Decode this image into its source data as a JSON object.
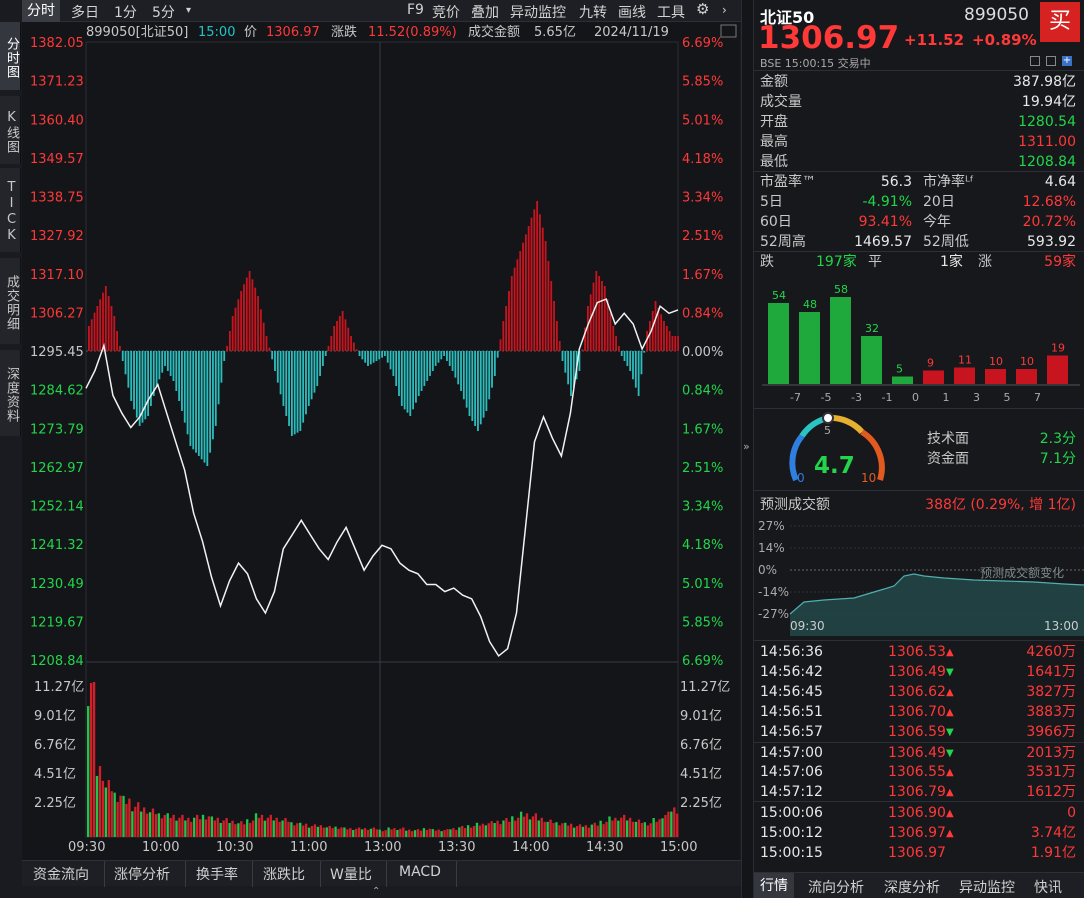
{
  "sidebar": {
    "tabs": [
      "分时图",
      "K线图",
      "TICK",
      "成交明细",
      "深度资料"
    ]
  },
  "toolbar": {
    "tabs": [
      "分时",
      "多日",
      "1分",
      "5分"
    ],
    "menu": [
      "F9",
      "竞价",
      "叠加",
      "异动监控",
      "九转",
      "画线",
      "工具"
    ]
  },
  "header": {
    "code_name": "899050[北证50]",
    "time": "15:00",
    "price_label": "价",
    "price": "1306.97",
    "change_label": "涨跌",
    "change": "11.52(0.89%)",
    "amount_label": "成交金额",
    "amount": "5.65亿",
    "date": "2024/11/19"
  },
  "chart_data": {
    "type": "line",
    "title": "",
    "x_ticks": [
      "09:30",
      "10:00",
      "10:30",
      "11:00",
      "13:00",
      "13:30",
      "14:00",
      "14:30",
      "15:00"
    ],
    "y_left": [
      "1382.05",
      "1371.23",
      "1360.40",
      "1349.57",
      "1338.75",
      "1327.92",
      "1317.10",
      "1306.27",
      "1295.45",
      "1284.62",
      "1273.79",
      "1262.97",
      "1252.14",
      "1241.32",
      "1230.49",
      "1219.67",
      "1208.84"
    ],
    "y_right": [
      "6.69%",
      "5.85%",
      "5.01%",
      "4.18%",
      "3.34%",
      "2.51%",
      "1.67%",
      "0.84%",
      "0.00%",
      "0.84%",
      "1.67%",
      "2.51%",
      "3.34%",
      "4.18%",
      "5.01%",
      "5.85%",
      "6.69%"
    ],
    "vol_left": [
      "11.27亿",
      "9.01亿",
      "6.76亿",
      "4.51亿",
      "2.25亿"
    ],
    "vol_right": [
      "11.27亿",
      "9.01亿",
      "6.76亿",
      "4.51亿",
      "2.25亿"
    ],
    "ylim": [
      1208.84,
      1382.05
    ],
    "prev_close": 1295.45,
    "price": [
      1285,
      1290,
      1297,
      1283,
      1278,
      1274,
      1277,
      1282,
      1286,
      1278,
      1270,
      1262,
      1250,
      1242,
      1232,
      1224,
      1231,
      1236,
      1233,
      1226,
      1222,
      1228,
      1240,
      1244,
      1248,
      1244,
      1240,
      1237,
      1242,
      1246,
      1240,
      1234,
      1238,
      1241,
      1240,
      1236,
      1234,
      1233,
      1230,
      1230,
      1228,
      1229,
      1227,
      1226,
      1221,
      1214,
      1210,
      1212,
      1222,
      1246,
      1270,
      1277,
      1271,
      1266,
      1278,
      1296,
      1303,
      1309,
      1310,
      1303,
      1306,
      1303,
      1296,
      1301,
      1308,
      1306,
      1306.97
    ],
    "macd_bars": [
      5,
      9,
      13,
      7,
      -2,
      -10,
      -15,
      -13,
      -7,
      -3,
      -6,
      -12,
      -19,
      -21,
      -23,
      -15,
      -2,
      7,
      12,
      16,
      11,
      3,
      -4,
      -11,
      -17,
      -16,
      -11,
      -7,
      -1,
      5,
      8,
      3,
      -1,
      -3,
      -2,
      -1,
      -5,
      -11,
      -13,
      -9,
      -6,
      -3,
      -1,
      -4,
      -8,
      -13,
      -16,
      -12,
      -5,
      6,
      15,
      20,
      25,
      30,
      22,
      10,
      -2,
      -9,
      -4,
      9,
      16,
      13,
      5,
      -1,
      -4,
      -9,
      4,
      10,
      6,
      3
    ]
  },
  "volume_bars": [
    11.2,
    4.8,
    3.6,
    3.0,
    2.6,
    2.2,
    2.0,
    1.8,
    1.6,
    1.5,
    1.4,
    1.3,
    1.4,
    1.5,
    1.3,
    1.2,
    1.1,
    1.0,
    1.2,
    1.5,
    1.4,
    1.3,
    1.2,
    1.0,
    0.9,
    0.8,
    0.8,
    0.7,
    0.7,
    0.6,
    0.6,
    0.6,
    0.6,
    0.5,
    0.6,
    0.6,
    0.5,
    0.5,
    0.6,
    0.5,
    0.5,
    0.6,
    0.7,
    0.8,
    0.9,
    1.0,
    1.1,
    1.2,
    1.4,
    1.6,
    1.5,
    1.3,
    1.1,
    1.0,
    0.9,
    0.8,
    0.8,
    0.9,
    1.1,
    1.3,
    1.4,
    1.3,
    1.1,
    1.0,
    1.2,
    1.6,
    2.0
  ],
  "bottom_tabs": [
    "资金流向",
    "涨停分析",
    "换手率",
    "涨跌比",
    "W量比",
    "MACD"
  ],
  "quote": {
    "name": "北证50",
    "code": "899050",
    "buy_label": "买",
    "price": "1306.97",
    "change": "+11.52",
    "pct": "+0.89%",
    "status": "BSE 15:00:15 交易中",
    "rows1": [
      [
        "金额",
        "387.98亿",
        "white"
      ],
      [
        "成交量",
        "19.94亿",
        "white"
      ],
      [
        "开盘",
        "1280.54",
        "green"
      ],
      [
        "最高",
        "1311.00",
        "red"
      ],
      [
        "最低",
        "1208.84",
        "green"
      ]
    ],
    "pe_label": "市盈率™",
    "pe": "56.3",
    "pb_label": "市净率ᴸᶠ",
    "pb": "4.64",
    "rows2": [
      [
        "5日",
        "-4.91%",
        "green",
        "20日",
        "12.68%",
        "red"
      ],
      [
        "60日",
        "93.41%",
        "red",
        "今年",
        "20.72%",
        "red"
      ],
      [
        "52周高",
        "1469.57",
        "white",
        "52周低",
        "593.92",
        "white"
      ]
    ],
    "breadth": {
      "down_label": "跌",
      "down": "197家",
      "flat_label": "平",
      "flat": "1家",
      "up_label": "涨",
      "up": "59家"
    },
    "dist": {
      "labels": [
        "-7",
        "-5",
        "-3",
        "-1",
        "0",
        "1",
        "3",
        "5",
        "7"
      ],
      "values": [
        54,
        48,
        58,
        32,
        5,
        9,
        11,
        10,
        10,
        19
      ]
    },
    "gauge": {
      "value": "4.7",
      "min": "0",
      "mid": "5",
      "max": "10",
      "tech_label": "技术面",
      "tech": "2.3分",
      "fund_label": "资金面",
      "fund": "7.1分"
    },
    "forecast": {
      "label": "预测成交额",
      "value": "388亿 (0.29%, 增 1亿)",
      "yticks": [
        "27%",
        "14%",
        "0%",
        "-14%",
        "-27%"
      ],
      "note": "预测成交额变化",
      "x_start": "09:30",
      "x_end": "13:00"
    },
    "ticks": [
      [
        "14:56:36",
        "1306.53",
        "up",
        "4260万"
      ],
      [
        "14:56:42",
        "1306.49",
        "down",
        "1641万"
      ],
      [
        "14:56:45",
        "1306.62",
        "up",
        "3827万"
      ],
      [
        "14:56:51",
        "1306.70",
        "up",
        "3883万"
      ],
      [
        "14:56:57",
        "1306.59",
        "down",
        "3966万"
      ],
      [
        "14:57:00",
        "1306.49",
        "down",
        "2013万"
      ],
      [
        "14:57:06",
        "1306.55",
        "up",
        "3531万"
      ],
      [
        "14:57:12",
        "1306.79",
        "up",
        "1612万"
      ],
      [
        "15:00:06",
        "1306.90",
        "up",
        "0"
      ],
      [
        "15:00:12",
        "1306.97",
        "up",
        "3.74亿"
      ],
      [
        "15:00:15",
        "1306.97",
        "",
        "1.91亿"
      ]
    ],
    "tabs": [
      "行情",
      "流向分析",
      "深度分析",
      "异动监控",
      "快讯"
    ]
  }
}
